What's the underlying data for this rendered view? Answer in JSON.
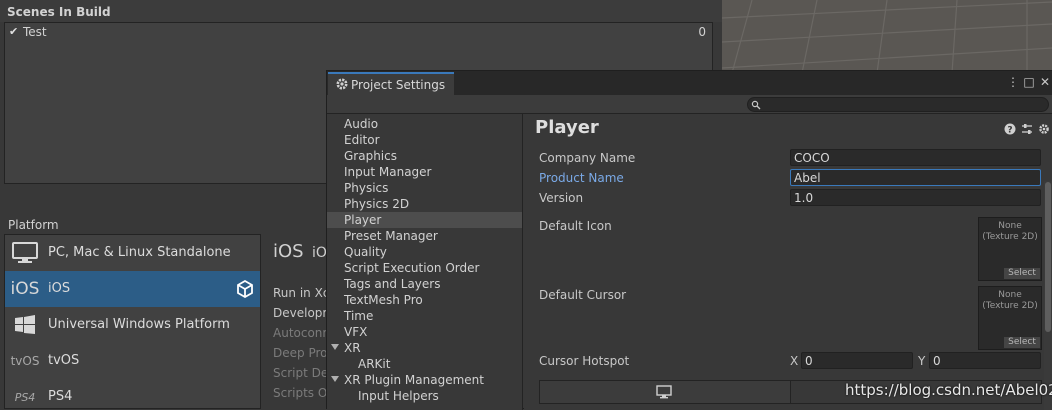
{
  "build_settings": {
    "scenes_header": "Scenes In Build",
    "scenes": [
      {
        "checked": "✔",
        "name": "Test",
        "index": "0"
      }
    ],
    "platform_label": "Platform",
    "platforms": [
      {
        "icon": "monitor-icon",
        "name": "PC, Mac & Linux Standalone",
        "selected": false
      },
      {
        "icon": "ios-icon",
        "icon_text": "iOS",
        "name": "iOS",
        "selected": true
      },
      {
        "icon": "windows-icon",
        "name": "Universal Windows Platform",
        "selected": false
      },
      {
        "icon": "tvos-icon",
        "icon_text": "tvOS",
        "name": "tvOS",
        "selected": false
      },
      {
        "icon": "ps4-icon",
        "icon_text": "PS4",
        "name": "PS4",
        "selected": false
      }
    ],
    "ios_panel": {
      "icon_text": "iOS",
      "title": "iOS",
      "options": [
        "Run in Xc",
        "Developm",
        "Autoconn",
        "Deep Pro",
        "Script De",
        "Scripts On"
      ]
    }
  },
  "project_settings": {
    "tab_label": "Project Settings",
    "window_controls": {
      "menu": "⋮",
      "maximize": "□",
      "close": "✕"
    },
    "search": {
      "value": "",
      "placeholder": ""
    },
    "sidebar": [
      {
        "label": "Audio"
      },
      {
        "label": "Editor"
      },
      {
        "label": "Graphics"
      },
      {
        "label": "Input Manager"
      },
      {
        "label": "Physics"
      },
      {
        "label": "Physics 2D"
      },
      {
        "label": "Player",
        "selected": true
      },
      {
        "label": "Preset Manager"
      },
      {
        "label": "Quality"
      },
      {
        "label": "Script Execution Order"
      },
      {
        "label": "Tags and Layers"
      },
      {
        "label": "TextMesh Pro"
      },
      {
        "label": "Time"
      },
      {
        "label": "VFX"
      },
      {
        "label": "XR",
        "expanded": true
      },
      {
        "label": "ARKit",
        "child": true
      },
      {
        "label": "XR Plugin Management",
        "expanded": true
      },
      {
        "label": "Input Helpers",
        "child": true
      }
    ],
    "content": {
      "title": "Player",
      "fields": {
        "company_name": {
          "label": "Company Name",
          "value": "COCO"
        },
        "product_name": {
          "label": "Product Name",
          "value": "Abel"
        },
        "version": {
          "label": "Version",
          "value": "1.0"
        },
        "default_icon": {
          "label": "Default Icon",
          "texture_line1": "None",
          "texture_line2": "(Texture 2D)",
          "select": "Select"
        },
        "default_cursor": {
          "label": "Default Cursor",
          "texture_line1": "None",
          "texture_line2": "(Texture 2D)",
          "select": "Select"
        },
        "cursor_hotspot": {
          "label": "Cursor Hotspot",
          "x_label": "X",
          "x_value": "0",
          "y_label": "Y",
          "y_value": "0"
        }
      }
    }
  },
  "watermark": "https://blog.csdn.net/Abel02",
  "colors": {
    "selection": "#2c5d87",
    "focus_accent": "#3a79bb",
    "focus_label": "#7aa9e6",
    "panel": "#383838"
  }
}
